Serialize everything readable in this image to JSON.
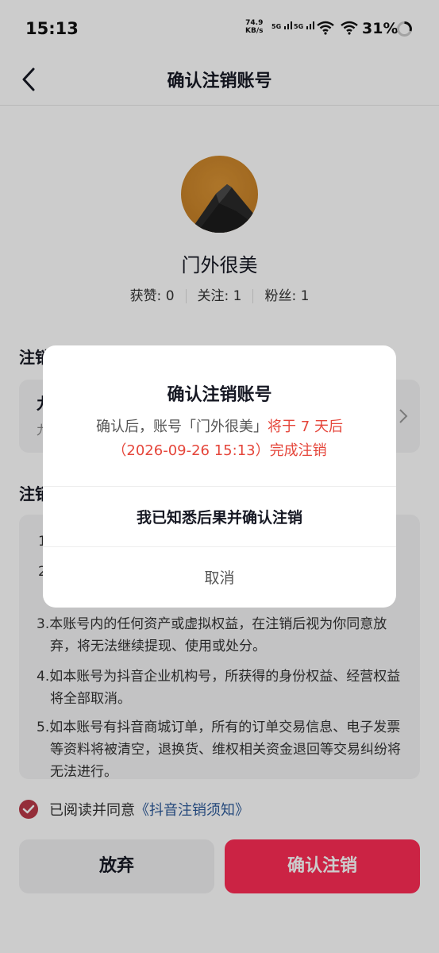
{
  "status_bar": {
    "time": "15:13",
    "net_speed_value": "74.9",
    "net_speed_unit": "KB/s",
    "signal1": "5G",
    "signal2": "5G",
    "battery": "31%"
  },
  "nav": {
    "title": "确认注销账号"
  },
  "profile": {
    "name": "门外很美",
    "likes": "获赞: 0",
    "following": "关注: 1",
    "followers": "粉丝: 1"
  },
  "sections": {
    "section1_title": "注销",
    "section1_line1": "九",
    "section1_line2": "九",
    "section2_title": "注销"
  },
  "terms": {
    "t1_num": "1",
    "t2_num": "2",
    "t3": "3.本账号内的任何资产或虚拟权益，在注销后视为你同意放弃，将无法继续提现、使用或处分。",
    "t4": "4.如本账号为抖音企业机构号，所获得的身份权益、经营权益将全部取消。",
    "t5": "5.如本账号有抖音商城订单，所有的订单交易信息、电子发票等资料将被清空，退换货、维权相关资金退回等交易纠纷将无法进行。"
  },
  "agreement": {
    "prefix": "已阅读并同意",
    "link": "《抖音注销须知》"
  },
  "buttons": {
    "give_up": "放弃",
    "confirm": "确认注销"
  },
  "dialog": {
    "title": "确认注销账号",
    "msg_prefix": "确认后，账号「门外很美」",
    "msg_red1": "将于 7 天后",
    "msg_red2": "（2026-09-26 15:13）完成注销",
    "confirm_action": "我已知悉后果并确认注销",
    "cancel": "取消"
  },
  "colors": {
    "accent": "#fe2c55",
    "link": "#2d5b9a",
    "warning": "#e5463b"
  }
}
